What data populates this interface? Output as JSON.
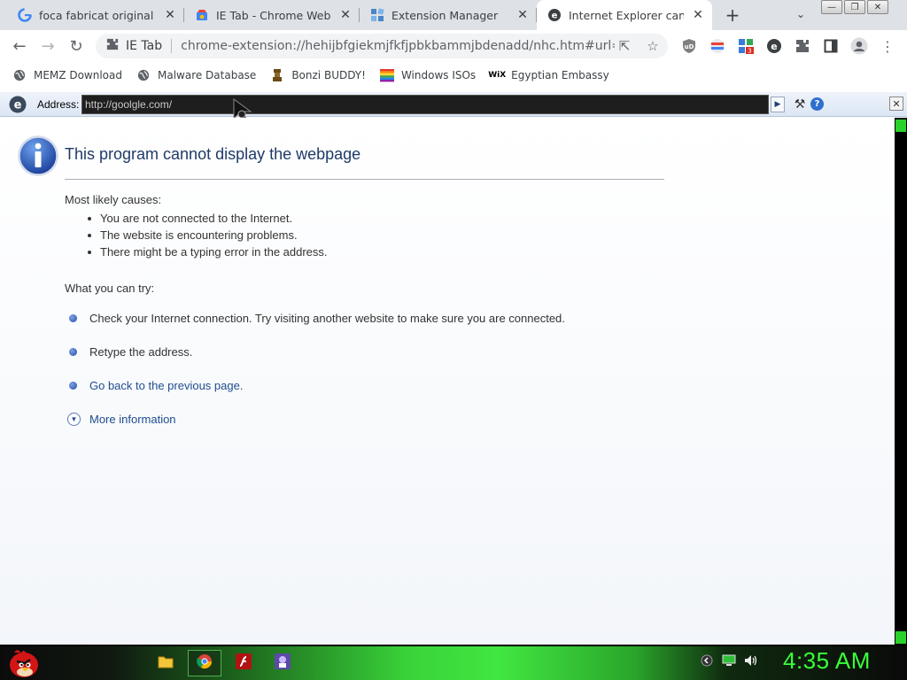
{
  "browser": {
    "tabs": [
      {
        "title": "foca fabricat original cu a",
        "favicon": "google-icon",
        "active": false
      },
      {
        "title": "IE Tab - Chrome Web Sto",
        "favicon": "chrome-web-store-icon",
        "active": false
      },
      {
        "title": "Extension Manager",
        "favicon": "extension-manager-icon",
        "active": false
      },
      {
        "title": "Internet Explorer cannot",
        "favicon": "ie-icon",
        "active": true
      }
    ],
    "new_tab_label": "+",
    "window_controls": {
      "minimize": "—",
      "restore": "❐",
      "close": "✕"
    }
  },
  "toolbar": {
    "chip_label": "IE Tab",
    "url": "chrome-extension://hehijbfgiekmjfkfjpbkbammjbdenadd/nhc.htm#url=http://...",
    "extensions": [
      "ublock-icon",
      "translate-icon",
      "extension-badge-icon",
      "ie-tab-icon",
      "puzzle-icon",
      "sidepanel-icon",
      "profile-icon",
      "menu-icon"
    ],
    "extension_badge": "3"
  },
  "bookmarks": [
    {
      "label": "MEMZ Download",
      "icon": "globe-icon"
    },
    {
      "label": "Malware Database",
      "icon": "globe-icon"
    },
    {
      "label": "Bonzi BUDDY!",
      "icon": "bonzi-icon"
    },
    {
      "label": "Windows ISOs",
      "icon": "windows-flag-icon"
    },
    {
      "label": "Egyptian Embassy",
      "icon": "wix-icon"
    }
  ],
  "iebar": {
    "address_label": "Address:",
    "address_value": "http://goolgle.com/",
    "go_label": "▶",
    "help_label": "?",
    "close_label": "✕"
  },
  "page": {
    "title": "This program cannot display the webpage",
    "causes_label": "Most likely causes:",
    "causes": [
      "You are not connected to the Internet.",
      "The website is encountering problems.",
      "There might be a typing error in the address."
    ],
    "try_label": "What you can try:",
    "try_items": [
      {
        "text": "Check your Internet connection. Try visiting another website to make sure you are connected.",
        "link": false
      },
      {
        "text": "Retype the address.",
        "link": false
      },
      {
        "text": "Go back to the previous page.",
        "link": true
      }
    ],
    "more_info": "More information"
  },
  "taskbar": {
    "items": [
      "folder-icon",
      "chrome-icon",
      "flash-icon",
      "app-icon"
    ],
    "clock": "4:35 AM"
  },
  "colors": {
    "tabstrip": "#dee1e6",
    "title_blue": "#1f3a68",
    "link_blue": "#1f4d8f",
    "clock_green": "#39ff39"
  }
}
